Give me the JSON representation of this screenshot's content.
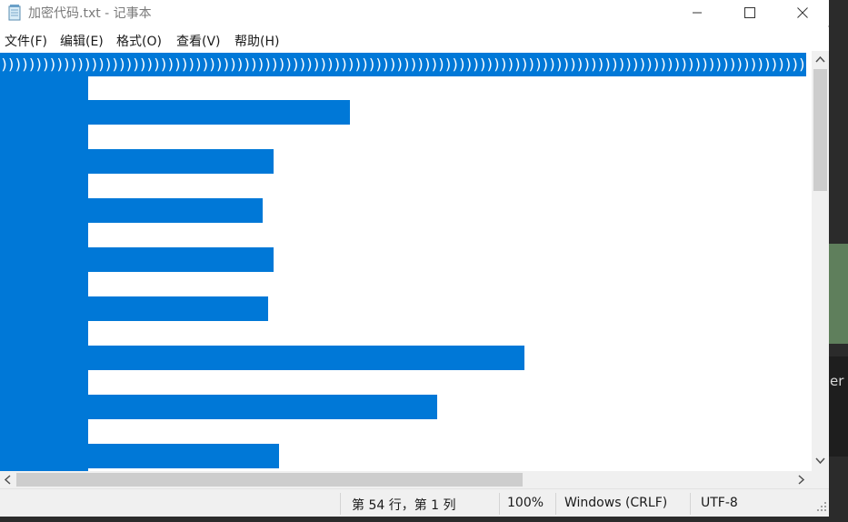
{
  "window": {
    "title": "加密代码.txt - 记事本"
  },
  "titlebar": {
    "icon": "notepad-icon",
    "buttons": [
      "minimize-icon",
      "maximize-icon",
      "close-icon"
    ]
  },
  "menubar": {
    "items": [
      "文件(F)",
      "编辑(E)",
      "格式(O)",
      "查看(V)",
      "帮助(H)"
    ]
  },
  "editor": {
    "first_line_text": "))))))))))))))))))))))))))))))))))))))))))))))))))))))))))))))))))))))))))))))))))))))))))))))))))))))))))))))))))))))))",
    "selection_color": "#0078d7"
  },
  "statusbar": {
    "position": "第 54 行，第 1 列",
    "zoom": "100%",
    "line_ending": "Windows (CRLF)",
    "encoding": "UTF-8"
  },
  "colors": {
    "accent": "#0078d7",
    "chrome": "#f0f0f0",
    "thumb": "#cdcdcd"
  }
}
